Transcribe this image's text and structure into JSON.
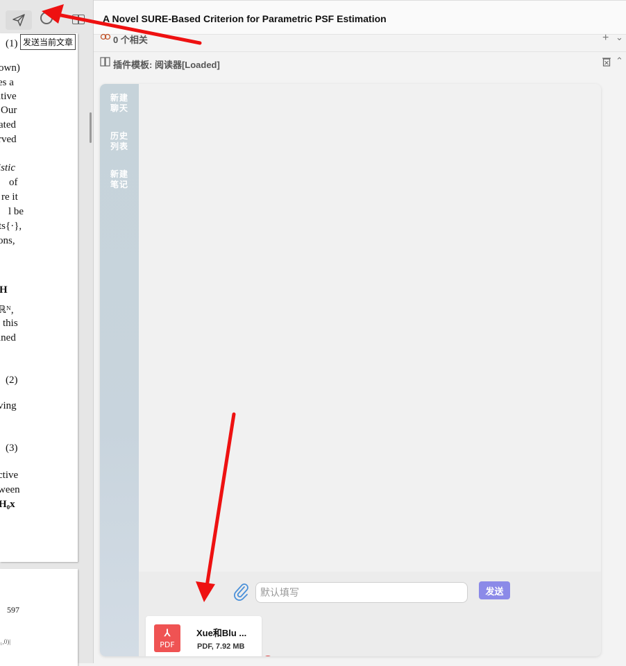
{
  "toolbar": {
    "tooltip": "发送当前文章"
  },
  "doc": {
    "title": "A Novel SURE-Based Criterion for Parametric PSF Estimation",
    "related": "0 个相关",
    "plugin": "插件模板: 阅读器[Loaded]"
  },
  "pdf": {
    "lines": [
      "(1)",
      "own)",
      "es a",
      "itive",
      "Our",
      "ated",
      "rved",
      "istic",
      "of",
      "re it",
      "l be",
      "ts{·},",
      "ons,",
      "H",
      "ℝᴺ,",
      "this",
      "ined",
      "(2)",
      "ving",
      "(3)",
      "ctive",
      "ween",
      "H₀x"
    ],
    "page2": [
      "597",
      "ₑ₁,0)|"
    ]
  },
  "chat": {
    "side_items": [
      {
        "line1": "新建",
        "line2": "聊天"
      },
      {
        "line1": "历史",
        "line2": "列表"
      },
      {
        "line1": "新建",
        "line2": "笔记"
      }
    ],
    "input_placeholder": "默认填写",
    "send_label": "发送",
    "attachment": {
      "name": "Xue和Blu ...",
      "meta": "PDF, 7.92 MB",
      "icon_label": "PDF"
    }
  },
  "colors": {
    "send": "#8b8ae8",
    "pdf": "#ef5353",
    "arrow": "#ee1111",
    "sidebar": "#c6d3da"
  }
}
